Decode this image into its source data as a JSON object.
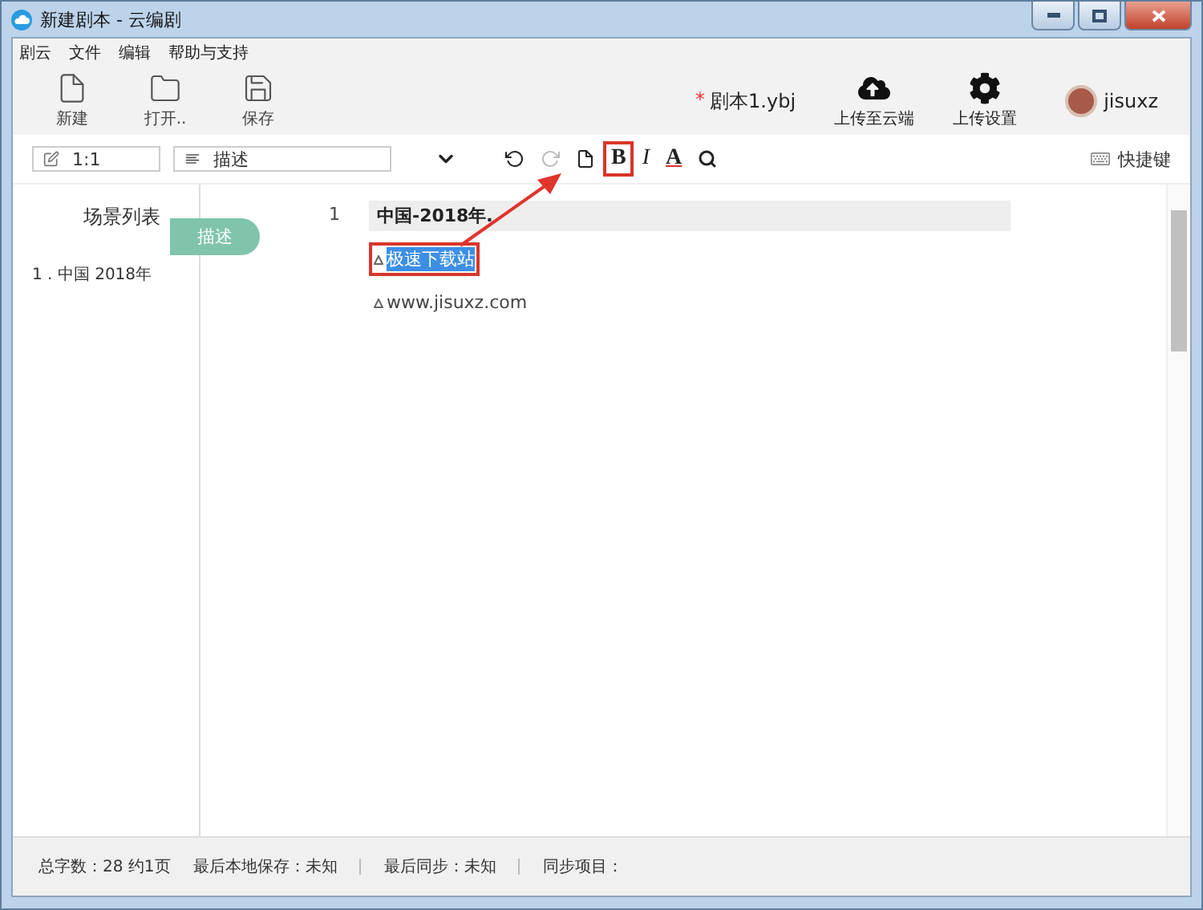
{
  "window": {
    "title": "新建剧本 - 云编剧"
  },
  "menu": [
    "剧云",
    "文件",
    "编辑",
    "帮助与支持"
  ],
  "toolbar": [
    {
      "kind": "new",
      "label": "新建"
    },
    {
      "kind": "open",
      "label": "打开.."
    },
    {
      "kind": "save",
      "label": "保存"
    }
  ],
  "file": {
    "marker": "*",
    "name": "剧本1.ybj"
  },
  "actions": [
    {
      "kind": "upload",
      "label": "上传至云端"
    },
    {
      "kind": "settings",
      "label": "上传设置"
    }
  ],
  "user": {
    "name": "jisuxz"
  },
  "format_bar": {
    "position": "1:1",
    "element": "描述",
    "tools": [
      {
        "kind": "undo",
        "disabled": false,
        "annotated": false
      },
      {
        "kind": "redo",
        "disabled": true,
        "annotated": false
      },
      {
        "kind": "page",
        "disabled": false,
        "annotated": false
      },
      {
        "kind": "bold",
        "label": "B",
        "disabled": false,
        "annotated": true
      },
      {
        "kind": "italic",
        "label": "I",
        "disabled": false,
        "annotated": false
      },
      {
        "kind": "color",
        "label": "A",
        "disabled": false,
        "annotated": false
      },
      {
        "kind": "search",
        "disabled": false,
        "annotated": false
      }
    ],
    "shortcut": "快捷键"
  },
  "sidebar": {
    "title": "场景列表",
    "scenes": [
      {
        "label": "1 . 中国 2018年",
        "selected": false
      }
    ]
  },
  "editor": {
    "line_number": "1",
    "tag": "描述",
    "lines": [
      {
        "kind": "scene",
        "text": "中国-2018年."
      },
      {
        "kind": "action",
        "text": "极速下载站",
        "selected": true,
        "annotated": true
      },
      {
        "kind": "action",
        "text": "www.jisuxz.com",
        "selected": false,
        "annotated": false
      }
    ]
  },
  "status_bar": [
    "总字数：28 约1页",
    "最后本地保存：未知",
    "最后同步：未知",
    "同步项目："
  ]
}
